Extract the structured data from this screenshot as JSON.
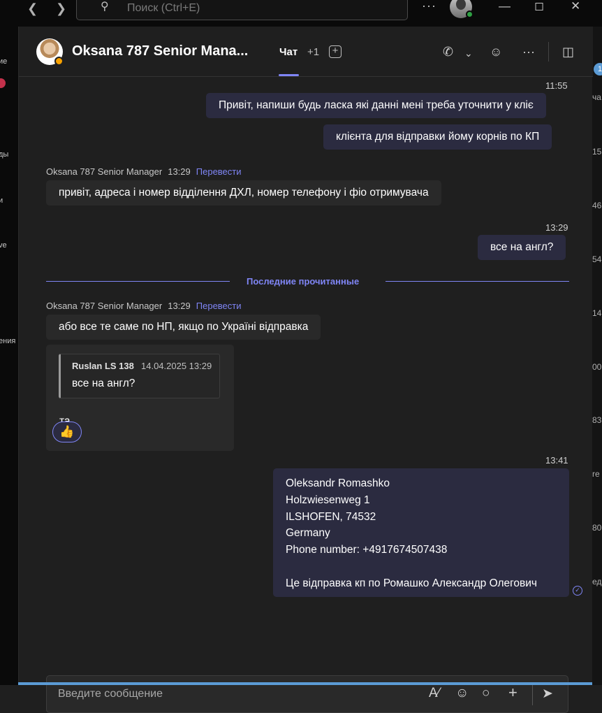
{
  "titlebar": {
    "search_placeholder": "Поиск (Ctrl+E)",
    "back_icon": "chevron-left-icon",
    "forward_icon": "chevron-right-icon",
    "more_icon": "more-horizontal-icon"
  },
  "left_rail": {
    "items": [
      "ие",
      "ды",
      "и",
      "ve",
      "ения"
    ]
  },
  "right_strip": {
    "items": [
      "ча",
      "15",
      "46",
      "54",
      "14",
      "00",
      "83",
      "re",
      "80",
      "ед"
    ],
    "badge": "1"
  },
  "header": {
    "title": "Oksana 787 Senior Mana...",
    "tab_chat": "Чат",
    "extra_tabs": "+1"
  },
  "messages": {
    "ts1": "11:55",
    "out1": "Привіт, напиши будь ласка які данні мені треба уточнити у кліє",
    "out2": "клієнта для відправки йому корнів по КП",
    "sender1": "Oksana 787 Senior Manager",
    "sender1_time": "13:29",
    "translate": "Перевести",
    "in1": "привіт, адреса і номер відділення ДХЛ, номер телефону і фіо отримувача",
    "ts2": "13:29",
    "out3": "все на англ?",
    "divider": "Последние прочитанные",
    "sender2": "Oksana 787 Senior Manager",
    "sender2_time": "13:29",
    "in2": "або все те саме по НП, якщо по Україні відправка",
    "quote_name": "Ruslan LS 138",
    "quote_date": "14.04.2025 13:29",
    "quote_text": "все на англ?",
    "reply": "та",
    "reaction": "👍",
    "ts3": "13:41",
    "address": {
      "line1": "Oleksandr Romashko",
      "line2": "Holzwiesenweg 1",
      "line3": "ILSHOFEN, 74532",
      "line4": "Germany",
      "line5": "Phone number: +4917674507438",
      "line6": "Це відправка кп по Ромашко Александр Олегович"
    }
  },
  "composer": {
    "placeholder": "Введите сообщение"
  },
  "colors": {
    "accent": "#7f85f5",
    "outgoing_bubble": "#2b2b40",
    "incoming_bubble": "#292929",
    "background": "#1f1f1f",
    "away": "#f8a100"
  }
}
